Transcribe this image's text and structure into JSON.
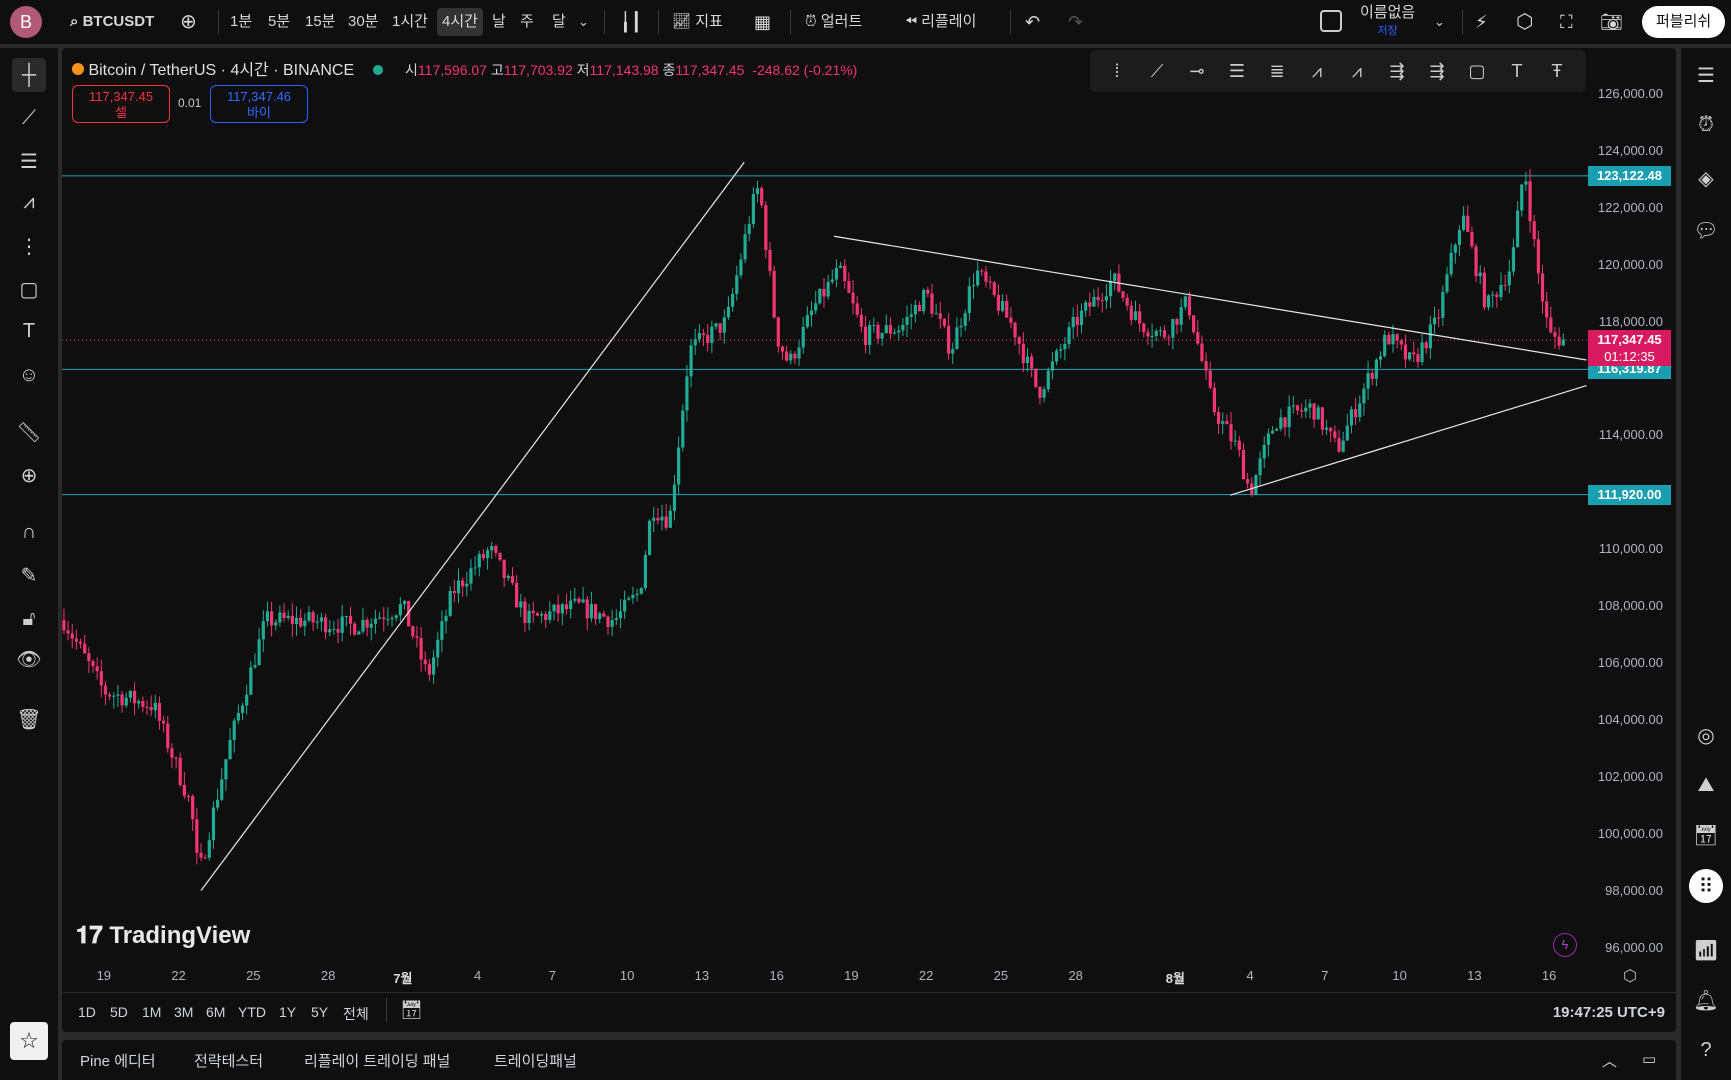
{
  "topbar": {
    "avatar_letter": "B",
    "symbol": "BTCUSDT",
    "intervals": [
      "1분",
      "5분",
      "15분",
      "30분",
      "1시간",
      "4시간",
      "날",
      "주",
      "달"
    ],
    "active_interval": "4시간",
    "indicators_label": "지표",
    "alert_label": "얼러트",
    "replay_label": "리플레이",
    "layout_name": "이름없음",
    "save_label": "저장",
    "publish_label": "퍼블리쉬"
  },
  "legend": {
    "title": "Bitcoin / TetherUS · 4시간 · BINANCE",
    "o_label": "시",
    "o": "117,596.07",
    "h_label": "고",
    "h": "117,703.92",
    "l_label": "저",
    "l": "117,143.98",
    "c_label": "종",
    "c": "117,347.45",
    "change": "-248.62 (-0.21%)",
    "sell_price": "117,347.45",
    "sell_label": "셀",
    "spread": "0.01",
    "buy_price": "117,347.46",
    "buy_label": "바이"
  },
  "price_axis": [
    "126,000.00",
    "124,000.00",
    "122,000.00",
    "120,000.00",
    "118,000.00",
    "114,000.00",
    "110,000.00",
    "108,000.00",
    "106,000.00",
    "104,000.00",
    "102,000.00",
    "100,000.00",
    "98,000.00",
    "96,000.00"
  ],
  "price_tags": {
    "h1": "123,122.48",
    "h2": "116,319.87",
    "h3": "111,920.00",
    "last": "117,347.45",
    "countdown": "01:12:35"
  },
  "time_axis": [
    "19",
    "22",
    "25",
    "28",
    "7월",
    "4",
    "7",
    "10",
    "13",
    "16",
    "19",
    "22",
    "25",
    "28",
    "8월",
    "4",
    "7",
    "10",
    "13",
    "16"
  ],
  "range_buttons": [
    "1D",
    "5D",
    "1M",
    "3M",
    "6M",
    "YTD",
    "1Y",
    "5Y",
    "전체"
  ],
  "clock": "19:47:25 UTC+9",
  "watermark": "TradingView",
  "bottom_tabs": [
    "Pine 에디터",
    "전략테스터",
    "리플레이 트레이딩 패널",
    "트레이딩패널"
  ],
  "colors": {
    "up": "#22ab94",
    "down": "#f23673",
    "hline": "#26a6b8",
    "last": "#d81b60",
    "accent_blue": "#2962ff"
  },
  "chart_data": {
    "type": "candlestick",
    "interval": "4h",
    "x_unit": "day offset from Jun 19",
    "y_range": [
      95500,
      126500
    ],
    "price_path": [
      [
        -1.6,
        107500
      ],
      [
        0,
        105000
      ],
      [
        2,
        104500
      ],
      [
        3.5,
        101000
      ],
      [
        3.8,
        98500
      ],
      [
        5,
        103000
      ],
      [
        6.5,
        107500
      ],
      [
        8,
        107500
      ],
      [
        10,
        107300
      ],
      [
        12,
        108000
      ],
      [
        13,
        105500
      ],
      [
        14,
        108500
      ],
      [
        15.5,
        110000
      ],
      [
        17,
        107500
      ],
      [
        19,
        108000
      ],
      [
        20.5,
        107500
      ],
      [
        21.5,
        108500
      ],
      [
        22,
        111500
      ],
      [
        22.7,
        111000
      ],
      [
        23.5,
        117000
      ],
      [
        25,
        118000
      ],
      [
        26,
        122000
      ],
      [
        26.3,
        122800
      ],
      [
        27,
        117500
      ],
      [
        27.5,
        116500
      ],
      [
        28.5,
        118500
      ],
      [
        29.5,
        119800
      ],
      [
        30.5,
        117500
      ],
      [
        32,
        117800
      ],
      [
        33,
        119000
      ],
      [
        34,
        117000
      ],
      [
        35,
        119800
      ],
      [
        36.5,
        117800
      ],
      [
        37.5,
        115500
      ],
      [
        39,
        118000
      ],
      [
        40.5,
        119500
      ],
      [
        41.5,
        118000
      ],
      [
        42.5,
        117500
      ],
      [
        43.5,
        118700
      ],
      [
        44.5,
        115000
      ],
      [
        45.5,
        113500
      ],
      [
        46,
        112000
      ],
      [
        47,
        114500
      ],
      [
        48.5,
        115000
      ],
      [
        49.5,
        113500
      ],
      [
        50.5,
        115500
      ],
      [
        51.5,
        117500
      ],
      [
        52.5,
        116500
      ],
      [
        53.5,
        118000
      ],
      [
        54.5,
        121800
      ],
      [
        55.5,
        118500
      ],
      [
        56.5,
        120000
      ],
      [
        57,
        123500
      ],
      [
        57.5,
        120000
      ],
      [
        58,
        117500
      ],
      [
        58.6,
        117347.45
      ]
    ],
    "trendlines": [
      [
        [
          3.9,
          98000
        ],
        [
          25.7,
          123600
        ]
      ],
      [
        [
          29.3,
          121000
        ],
        [
          59.5,
          116650
        ]
      ],
      [
        [
          45.2,
          111900
        ],
        [
          59.5,
          115750
        ]
      ]
    ],
    "horizontal_lines": [
      123122.48,
      116319.87,
      111920
    ],
    "last_price": 117347.45
  }
}
